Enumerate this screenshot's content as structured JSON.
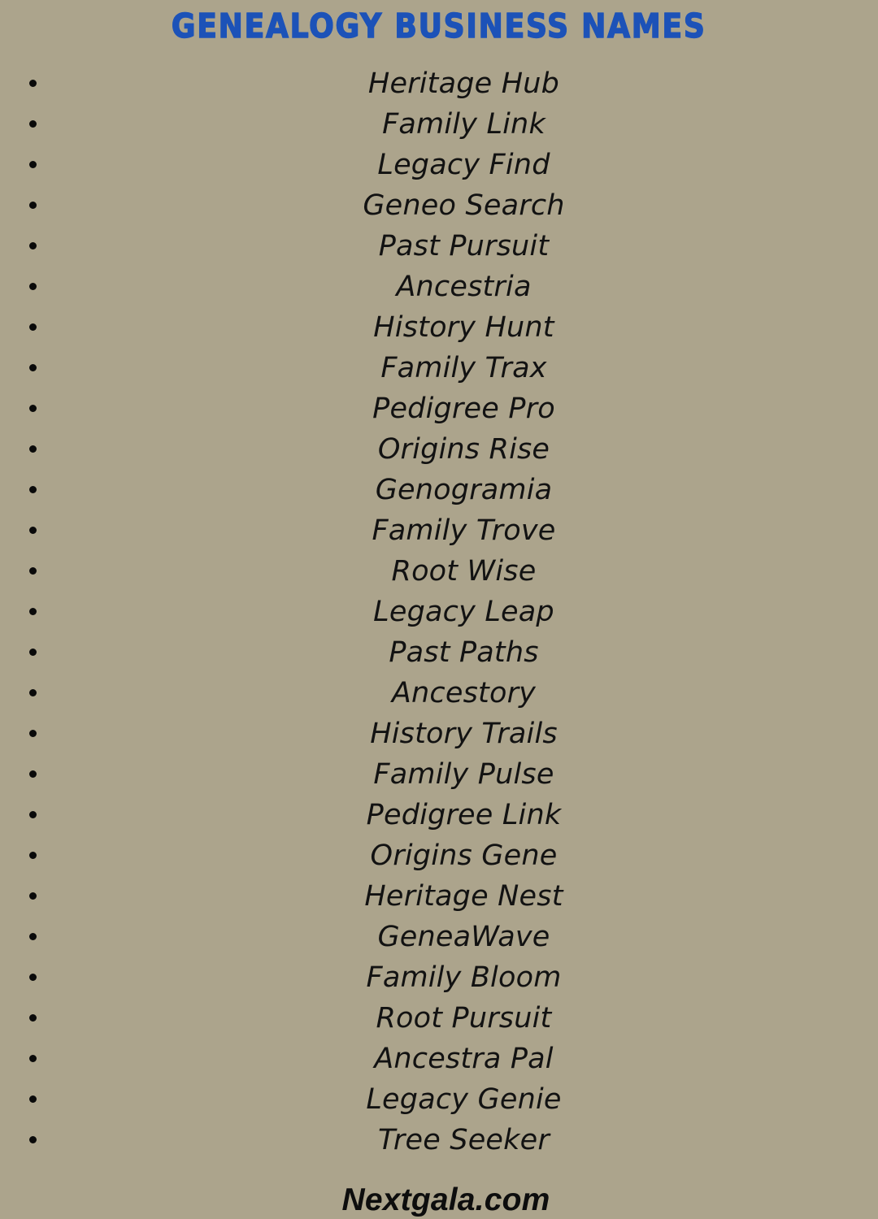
{
  "page": {
    "background_color": "#ACA48C",
    "text_color": "#121212"
  },
  "header": {
    "title": "Genealogy Business Names",
    "title_color": "#1C52B8"
  },
  "list": {
    "bullet_icon": "bullet-dot-icon",
    "bullet_color": "#0A0A0A",
    "items": [
      {
        "label": "Heritage Hub"
      },
      {
        "label": "Family Link"
      },
      {
        "label": "Legacy Find"
      },
      {
        "label": "Geneo Search"
      },
      {
        "label": "Past Pursuit"
      },
      {
        "label": "Ancestria"
      },
      {
        "label": "History Hunt"
      },
      {
        "label": "Family Trax"
      },
      {
        "label": "Pedigree Pro"
      },
      {
        "label": "Origins Rise"
      },
      {
        "label": "Genogramia"
      },
      {
        "label": "Family Trove"
      },
      {
        "label": "Root Wise"
      },
      {
        "label": "Legacy Leap"
      },
      {
        "label": "Past Paths"
      },
      {
        "label": "Ancestory"
      },
      {
        "label": "History Trails"
      },
      {
        "label": "Family Pulse"
      },
      {
        "label": "Pedigree Link"
      },
      {
        "label": "Origins Gene"
      },
      {
        "label": "Heritage Nest"
      },
      {
        "label": "GeneaWave"
      },
      {
        "label": "Family Bloom"
      },
      {
        "label": "Root Pursuit"
      },
      {
        "label": "Ancestra Pal"
      },
      {
        "label": "Legacy Genie"
      },
      {
        "label": "Tree Seeker"
      }
    ]
  },
  "footer": {
    "site": "Nextgala.com"
  }
}
